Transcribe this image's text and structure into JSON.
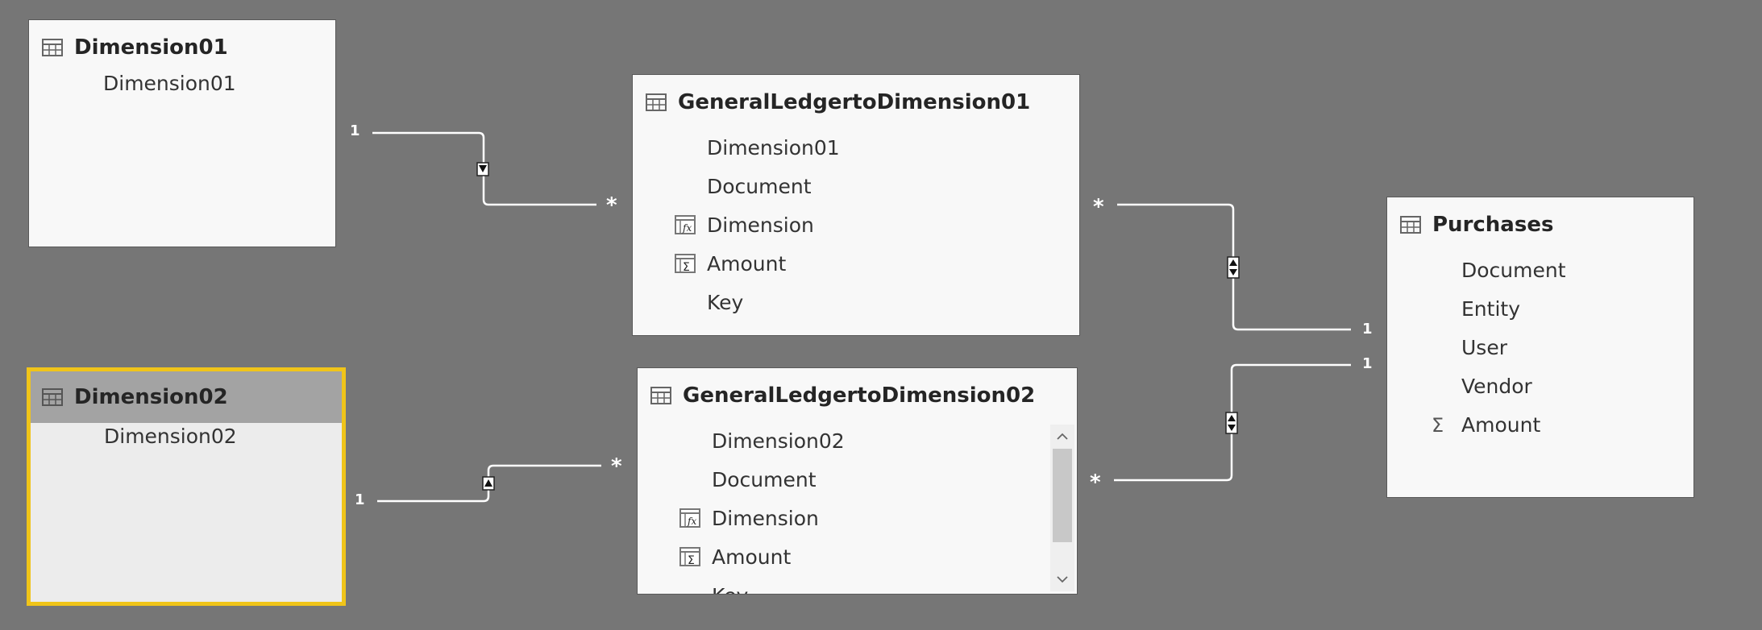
{
  "tables": [
    {
      "name": "Dimension01",
      "fields": [
        {
          "label": "Dimension01",
          "icon": ""
        }
      ]
    },
    {
      "name": "Dimension02",
      "selected": true,
      "fields": [
        {
          "label": "Dimension02",
          "icon": ""
        }
      ]
    },
    {
      "name": "GeneralLedgertoDimension01",
      "fields": [
        {
          "label": "Dimension01",
          "icon": ""
        },
        {
          "label": "Document",
          "icon": ""
        },
        {
          "label": "Dimension",
          "icon": "calculated-column-icon"
        },
        {
          "label": "Amount",
          "icon": "sum-column-icon"
        },
        {
          "label": "Key",
          "icon": ""
        }
      ]
    },
    {
      "name": "GeneralLedgertoDimension02",
      "fields": [
        {
          "label": "Dimension02",
          "icon": ""
        },
        {
          "label": "Document",
          "icon": ""
        },
        {
          "label": "Dimension",
          "icon": "calculated-column-icon"
        },
        {
          "label": "Amount",
          "icon": "sum-column-icon"
        },
        {
          "label": "Key",
          "icon": ""
        }
      ]
    },
    {
      "name": "Purchases",
      "fields": [
        {
          "label": "Document",
          "icon": ""
        },
        {
          "label": "Entity",
          "icon": ""
        },
        {
          "label": "User",
          "icon": ""
        },
        {
          "label": "Vendor",
          "icon": ""
        },
        {
          "label": "Amount",
          "icon": "sigma-icon"
        }
      ]
    }
  ],
  "relationships": [
    {
      "from": "Dimension01",
      "to": "GeneralLedgertoDimension01",
      "from_cardinality": "1",
      "to_cardinality": "*",
      "cross_filter": "single"
    },
    {
      "from": "Dimension02",
      "to": "GeneralLedgertoDimension02",
      "from_cardinality": "1",
      "to_cardinality": "*",
      "cross_filter": "single"
    },
    {
      "from": "Purchases",
      "to": "GeneralLedgertoDimension01",
      "from_cardinality": "1",
      "to_cardinality": "*",
      "cross_filter": "both"
    },
    {
      "from": "Purchases",
      "to": "GeneralLedgertoDimension02",
      "from_cardinality": "1",
      "to_cardinality": "*",
      "cross_filter": "both"
    }
  ],
  "colors": {
    "canvas": "#767676",
    "card": "#f8f8f8",
    "selected_border": "#f0c419",
    "selected_header": "#a3a3a3",
    "line": "#ffffff"
  }
}
